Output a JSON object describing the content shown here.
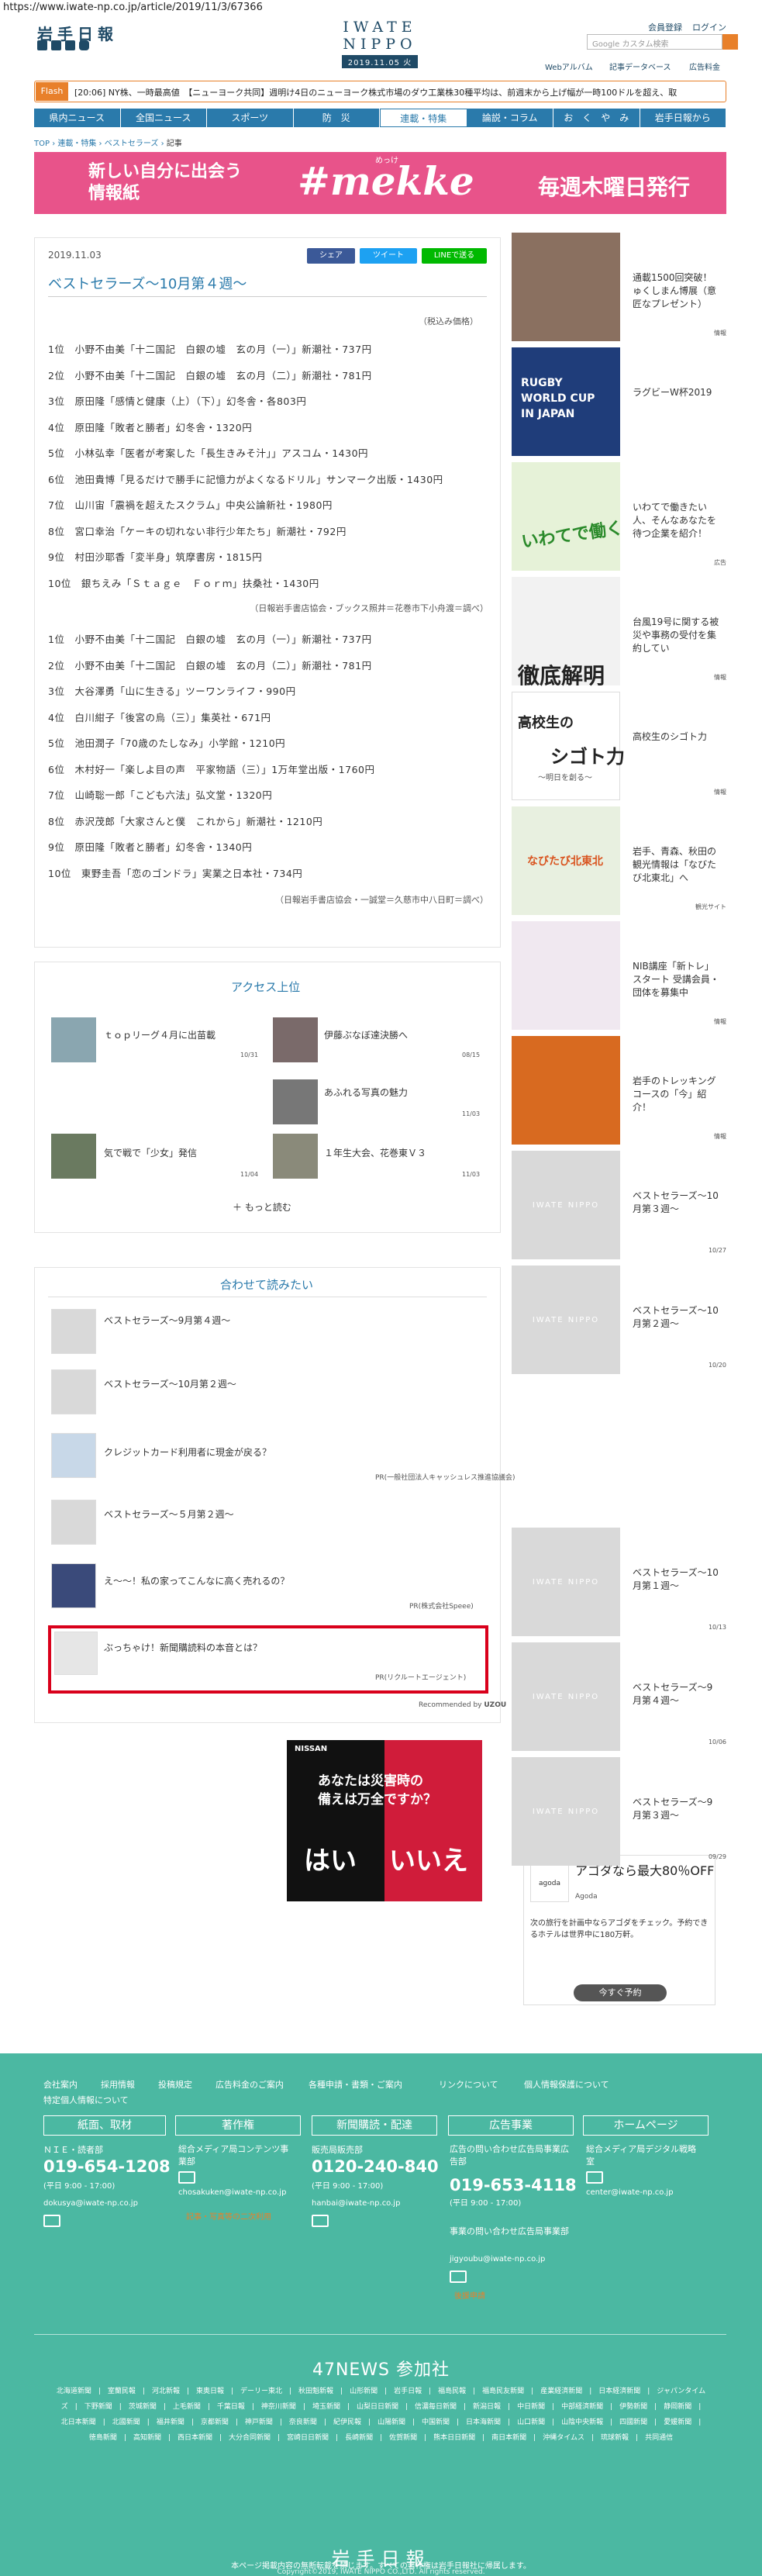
{
  "browser": {
    "url": "https://www.iwate-np.co.jp/article/2019/11/3/67366"
  },
  "header": {
    "logo": "岩手日報",
    "center_logo": "IWATE NIPPO",
    "date": "2019.11.05 火",
    "member": "会員登録",
    "login": "ログイン",
    "search_placeholder": "Google カスタム検索",
    "links": [
      "Webアルバム",
      "記事データベース",
      "広告料金"
    ]
  },
  "flash": {
    "label": "Flash",
    "text": "[20:06] NY株、一時最高値　【ニューヨーク共同】週明け4日のニューヨーク株式市場のダウ工業株30種平均は、前週末から上げ幅が一時100ドルを超え、取"
  },
  "nav": {
    "items": [
      "県内ニュース",
      "全国ニュース",
      "スポーツ",
      "防　災",
      "連載・特集",
      "論説・コラム",
      "お　く　や　み",
      "岩手日報から"
    ],
    "active": 4
  },
  "breadcrumb": [
    "TOP",
    "連載・特集",
    "ベストセラーズ",
    "記事"
  ],
  "banner": {
    "line1": "新しい自分に出会う",
    "line2": "情報紙",
    "brand": "#mekke",
    "ruby": "めっけ",
    "weekly": "毎週木曜日発行"
  },
  "article": {
    "date": "2019.11.03",
    "share_fb": "シェア",
    "share_tw": "ツイート",
    "share_line": "LINEで送る",
    "title": "ベストセラーズ～10月第４週～",
    "note": "（税込み価格）",
    "list1": [
      "1位　小野不由美「十二国記　白銀の墟　玄の月（一）」新潮社・737円",
      "2位　小野不由美「十二国記　白銀の墟　玄の月（二）」新潮社・781円",
      "3位　原田隆「感情と健康（上）（下）」幻冬舎・各803円",
      "4位　原田隆「敗者と勝者」幻冬舎・1320円",
      "5位　小林弘幸「医者が考案した「長生きみそ汁」」アスコム・1430円",
      "6位　池田貴博「見るだけで勝手に記憶力がよくなるドリル」サンマーク出版・1430円",
      "7位　山川宙「震禍を超えたスクラム」中央公論新社・1980円",
      "8位　宮口幸治「ケーキの切れない非行少年たち」新潮社・792円",
      "9位　村田沙耶香「変半身」筑摩書房・1815円",
      "10位　銀ちえみ「Ｓｔａｇｅ　Ｆｏｒｍ」扶桑社・1430円"
    ],
    "source1": "（日報岩手書店協会・ブックス照井＝花巻市下小舟渡＝調べ）",
    "list2": [
      "1位　小野不由美「十二国記　白銀の墟　玄の月（一）」新潮社・737円",
      "2位　小野不由美「十二国記　白銀の墟　玄の月（二）」新潮社・781円",
      "3位　大谷澤勇「山に生きる」ツーワンライフ・990円",
      "4位　白川紺子「後宮の烏（三）」集英社・671円",
      "5位　池田潤子「70歳のたしなみ」小学館・1210円",
      "6位　木村好一「楽しよ目の声　平家物語（三）」1万年堂出版・1760円",
      "7位　山崎聡一郎「こども六法」弘文堂・1320円",
      "8位　赤沢茂郎「大家さんと僕　これから」新潮社・1210円",
      "9位　原田隆「敗者と勝者」幻冬舎・1340円",
      "10位　東野圭吾「恋のゴンドラ」実業之日本社・734円"
    ],
    "source2": "（日報岩手書店協会・一誠堂＝久慈市中八日町＝調べ）"
  },
  "access": {
    "title": "アクセス上位",
    "items": [
      {
        "title": "ｔｏｐリーグ４月に出苗載",
        "date": "10/31"
      },
      {
        "title": "伊藤ぶなぼ達決勝へ",
        "date": "08/15"
      },
      {
        "title": "あふれる写真の魅力",
        "date": "11/03"
      },
      {
        "title": "気で戦で「少女」発信",
        "date": "11/04"
      },
      {
        "title": "１年生大会、花巻東Ｖ３",
        "date": "11/03"
      }
    ],
    "more": "もっと読む"
  },
  "related": {
    "title": "合わせて読みたい",
    "items": [
      {
        "title": "ベストセラーズ～9月第４週～",
        "pr": ""
      },
      {
        "title": "ベストセラーズ～10月第２週～",
        "pr": ""
      },
      {
        "title": "クレジットカード利用者に現金が戻る？",
        "pr": "PR(一般社団法人キャッシュレス推進協議会)"
      },
      {
        "title": "ベストセラーズ～５月第２週～",
        "pr": ""
      },
      {
        "title": "え～～！私の家ってこんなに高く売れるの？",
        "pr": "PR(株式会社Speee)"
      },
      {
        "title": "ぶっちゃけ！新聞購読料の本音とは？",
        "pr": "PR(リクルートエージェント)"
      }
    ],
    "recommend": "Recommended by",
    "uzou": "UZOU"
  },
  "ad": {
    "brand": "NISSAN",
    "line1": "あなたは災害時の",
    "line2": "備えは万全ですか？",
    "yes": "はい",
    "no": "いいえ"
  },
  "sidebar": [
    {
      "title": "通載1500回突破！ゅくしまん博展（意匠なプレゼント）",
      "tag": "情報"
    },
    {
      "title": "ラグビーW杯2019",
      "tag": ""
    },
    {
      "title": "いわてで働きたい人、そんなあなたを待つ企業を紹介！",
      "tag": "広告"
    },
    {
      "title": "台風19号に関する被災や事務の受付を集約してい",
      "tag": "情報"
    },
    {
      "title": "高校生のシゴト力",
      "tag": "情報"
    },
    {
      "title": "岩手、青森、秋田の観光情報は「なびたび北東北」へ",
      "tag": "観光サイト"
    },
    {
      "title": "NIB講座「新トレ」スタート 受講会員・団体を募集中",
      "tag": "情報"
    },
    {
      "title": "岩手のトレッキングコースの「今」紹介！",
      "tag": "情報"
    },
    {
      "title": "ベストセラーズ～10月第３週～",
      "tag": "10/27"
    },
    {
      "title": "ベストセラーズ～10月第２週～",
      "tag": "10/20"
    },
    {
      "title": "ベストセラーズ～10月第１週～",
      "tag": "10/13"
    },
    {
      "title": "ベストセラーズ～9月第４週～",
      "tag": "10/06"
    },
    {
      "title": "ベストセラーズ～9月第３週～",
      "tag": "09/29"
    }
  ],
  "sidebar_misc": {
    "rugby": "RUGBY WORLD CUP IN JAPAN",
    "iwate": "いわてで働く",
    "tetsuei": "徹底解明",
    "shigoto": "シゴト力",
    "shigoto_sub": "高校生の",
    "shigoto_note": "～明日を創る～",
    "navi": "なびたび北東北"
  },
  "agoda": {
    "logo": "agoda",
    "head": "アゴダなら最大80％OFF",
    "sub": "Agoda",
    "desc": "次の旅行を計画中ならアゴダをチェック。予約できるホテルは世界中に180万軒。",
    "btn": "今すぐ予約"
  },
  "footer": {
    "links": [
      "会社案内",
      "採用情報",
      "投稿規定",
      "広告料金のご案内",
      "各種申請・書類・ご案内",
      "リンクについて",
      "個人情報保護について",
      "特定個人情報について"
    ],
    "cols": [
      {
        "head": "紙面、取材",
        "label": "ＮＩＥ・読者部",
        "tel": "019-654-1208",
        "hours": "(平日 9:00 - 17:00)",
        "mail": "dokusya@iwate-np.co.jp"
      },
      {
        "head": "著作権",
        "label": "総合メディア局コンテンツ事業部",
        "mail": "chosakuken@iwate-np.co.jp",
        "link": "記事・写真等の二次利用"
      },
      {
        "head": "新聞購読・配達",
        "label": "販売局販売部",
        "tel": "0120-240-840",
        "hours": "(平日 9:00 - 17:00)",
        "mail": "hanbai@iwate-np.co.jp"
      },
      {
        "head": "広告事業",
        "label": "広告の問い合わせ広告局事業広告部",
        "tel": "019-653-4118",
        "hours": "(平日 9:00 - 17:00)",
        "label2": "事業の問い合わせ広告局事業部",
        "mail": "jigyoubu@iwate-np.co.jp",
        "link": "後援申請"
      },
      {
        "head": "ホームページ",
        "label": "総合メディア局デジタル戦略室",
        "mail": "center@iwate-np.co.jp"
      }
    ],
    "news47": "47NEWS 参加社",
    "papers": [
      "北海道新聞",
      "室蘭民報",
      "河北新報",
      "東奥日報",
      "デーリー東北",
      "秋田魁新報",
      "山形新聞",
      "岩手日報",
      "福島民報",
      "福島民友新聞",
      "産業経済新聞",
      "日本経済新聞",
      "ジャパンタイムズ",
      "下野新聞",
      "茨城新聞",
      "上毛新聞",
      "千葉日報",
      "神奈川新聞",
      "埼玉新聞",
      "山梨日日新聞",
      "信濃毎日新聞",
      "新潟日報",
      "中日新聞",
      "中部経済新聞",
      "伊勢新聞",
      "静岡新聞",
      "北日本新聞",
      "北國新聞",
      "福井新聞",
      "京都新聞",
      "神戸新聞",
      "奈良新聞",
      "紀伊民報",
      "山陽新聞",
      "中国新聞",
      "日本海新聞",
      "山口新聞",
      "山陰中央新報",
      "四國新聞",
      "愛媛新聞",
      "徳島新聞",
      "高知新聞",
      "西日本新聞",
      "大分合同新聞",
      "宮崎日日新聞",
      "長崎新聞",
      "佐賀新聞",
      "熊本日日新聞",
      "南日本新聞",
      "沖縄タイムス",
      "琉球新報",
      "共同通信"
    ],
    "logo": "岩手日報",
    "notice": "本ページ掲載内容の無断転載を禁じます。すべての著作権は岩手日報社に帰属します。",
    "copyright": "Copyright©2019, IWATE NIPPO CO.,LTD. All rights reserved."
  }
}
